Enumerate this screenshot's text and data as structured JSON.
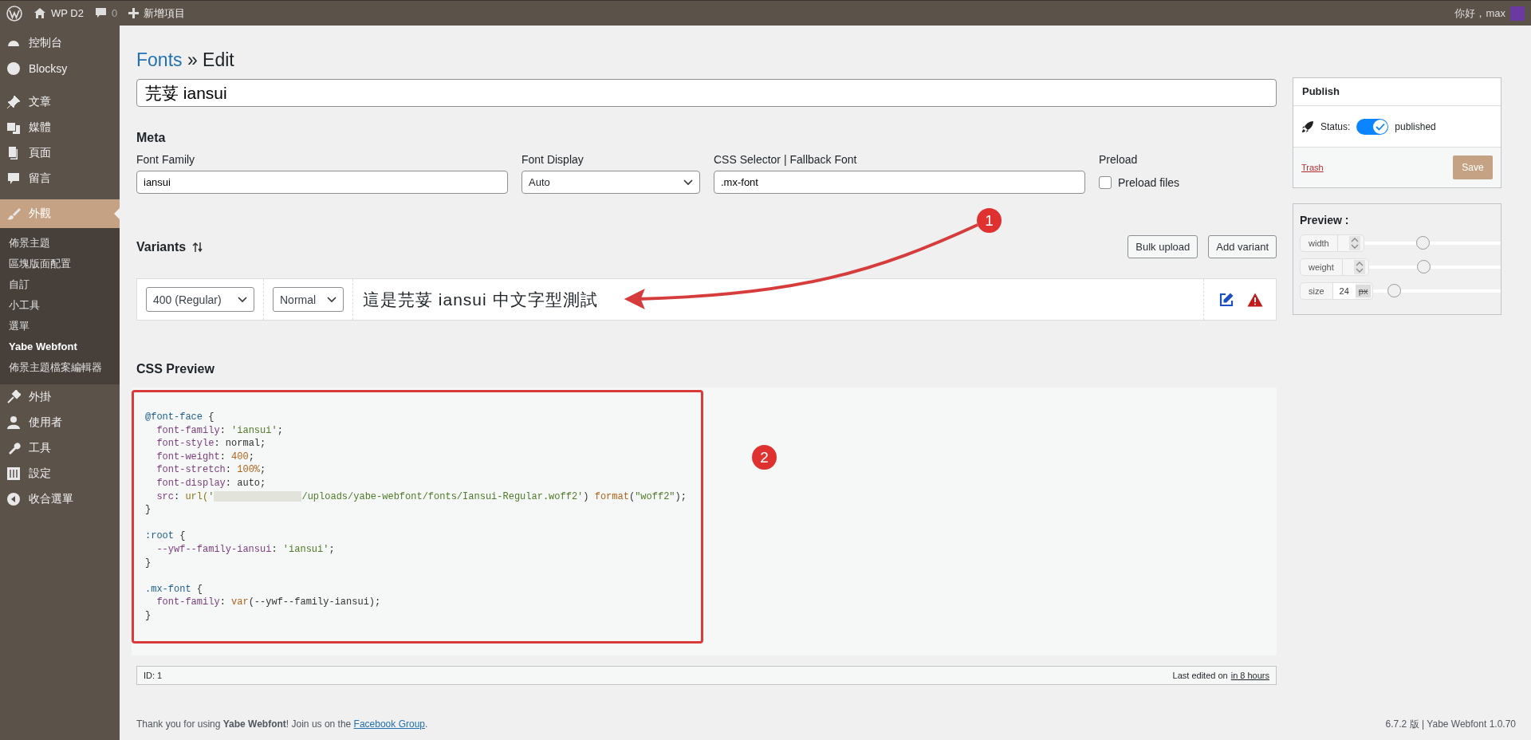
{
  "top_bar": {
    "site": "WP D2",
    "comments": "0",
    "new_item": "新增項目",
    "greeting": "你好，max"
  },
  "sidebar": {
    "groups": [
      {
        "items": [
          {
            "label": "控制台",
            "selected": false
          },
          {
            "label": "Blocksy",
            "selected": false
          }
        ]
      },
      {
        "items": [
          {
            "label": "文章",
            "selected": false
          },
          {
            "label": "媒體",
            "selected": false
          },
          {
            "label": "頁面",
            "selected": false
          },
          {
            "label": "留言",
            "selected": false
          }
        ]
      },
      {
        "items": [
          {
            "label": "外觀",
            "selected": true,
            "children": [
              {
                "label": "佈景主題",
                "selected": false
              },
              {
                "label": "區塊版面配置",
                "selected": false
              },
              {
                "label": "自訂",
                "selected": false
              },
              {
                "label": "小工具",
                "selected": false
              },
              {
                "label": "選單",
                "selected": false
              },
              {
                "label": "Yabe Webfont",
                "selected": true
              },
              {
                "label": "佈景主題檔案編輯器",
                "selected": false
              }
            ]
          },
          {
            "label": "外掛",
            "selected": false
          },
          {
            "label": "使用者",
            "selected": false
          },
          {
            "label": "工具",
            "selected": false
          },
          {
            "label": "設定",
            "selected": false
          },
          {
            "label": "收合選單",
            "selected": false
          }
        ]
      }
    ]
  },
  "breadcrumb": {
    "link": "Fonts",
    "current": "» Edit"
  },
  "title_field": {
    "value": "芫荽 iansui"
  },
  "meta": {
    "heading": "Meta",
    "font_family": {
      "label": "Font Family",
      "value": "iansui"
    },
    "font_display": {
      "label": "Font Display",
      "value": "Auto"
    },
    "css_selector": {
      "label": "CSS Selector | Fallback Font",
      "value": ".mx-font"
    },
    "preload": {
      "label": "Preload",
      "option": "Preload files",
      "checked": false
    }
  },
  "variants": {
    "heading": "Variants",
    "buttons": [
      "Bulk upload",
      "Add variant"
    ],
    "rows": [
      {
        "weight": "400 (Regular)",
        "style": "Normal",
        "preview": "這是芫荽 iansui 中文字型測試"
      }
    ]
  },
  "css_preview": {
    "heading": "CSS Preview",
    "blocks": [
      {
        "lines": [
          [
            {
              "kind": "selector",
              "text": "@font-face"
            },
            {
              "kind": "plain",
              "text": " {"
            }
          ],
          [
            {
              "kind": "prop",
              "text": "  font-family"
            },
            {
              "kind": "plain",
              "text": ": "
            },
            {
              "kind": "string",
              "text": "'iansui'"
            },
            {
              "kind": "plain",
              "text": ";"
            }
          ],
          [
            {
              "kind": "prop",
              "text": "  font-style"
            },
            {
              "kind": "plain",
              "text": ": normal;"
            }
          ],
          [
            {
              "kind": "prop",
              "text": "  font-weight"
            },
            {
              "kind": "plain",
              "text": ": "
            },
            {
              "kind": "number",
              "text": "400"
            },
            {
              "kind": "plain",
              "text": ";"
            }
          ],
          [
            {
              "kind": "prop",
              "text": "  font-stretch"
            },
            {
              "kind": "plain",
              "text": ": "
            },
            {
              "kind": "number",
              "text": "100%"
            },
            {
              "kind": "plain",
              "text": ";"
            }
          ],
          [
            {
              "kind": "prop",
              "text": "  font-display"
            },
            {
              "kind": "plain",
              "text": ": auto;"
            }
          ],
          [
            {
              "kind": "prop",
              "text": "  src"
            },
            {
              "kind": "plain",
              "text": ": "
            },
            {
              "kind": "func",
              "text": "url("
            },
            {
              "kind": "string",
              "text": "'"
            },
            {
              "kind": "redacted"
            },
            {
              "kind": "string",
              "text": "/uploads/yabe-webfont/fonts/Iansui-Regular.woff2'"
            },
            {
              "kind": "plain",
              "text": ") "
            },
            {
              "kind": "number",
              "text": "format"
            },
            {
              "kind": "plain",
              "text": "("
            },
            {
              "kind": "string",
              "text": "\"woff2\""
            },
            {
              "kind": "plain",
              "text": ");"
            }
          ],
          [
            {
              "kind": "plain",
              "text": "}"
            }
          ]
        ]
      },
      {
        "lines": [
          [
            {
              "kind": "selector",
              "text": ":root"
            },
            {
              "kind": "plain",
              "text": " {"
            }
          ],
          [
            {
              "kind": "prop",
              "text": "  --ywf--family-iansui"
            },
            {
              "kind": "plain",
              "text": ": "
            },
            {
              "kind": "string",
              "text": "'iansui'"
            },
            {
              "kind": "plain",
              "text": ";"
            }
          ],
          [
            {
              "kind": "plain",
              "text": "}"
            }
          ]
        ]
      },
      {
        "lines": [
          [
            {
              "kind": "selector",
              "text": ".mx-font"
            },
            {
              "kind": "plain",
              "text": " {"
            }
          ],
          [
            {
              "kind": "prop",
              "text": "  font-family"
            },
            {
              "kind": "plain",
              "text": ": "
            },
            {
              "kind": "number",
              "text": "var"
            },
            {
              "kind": "plain",
              "text": "(--ywf--family-iansui);"
            }
          ],
          [
            {
              "kind": "plain",
              "text": "}"
            }
          ]
        ]
      }
    ]
  },
  "status_bar": {
    "id": "ID: 1",
    "edited": "Last edited on",
    "edited_link": "in 8 hours"
  },
  "publish": {
    "title": "Publish",
    "status_label": "Status:",
    "status_on": true,
    "status_text": "published",
    "trash": "Trash",
    "save": "Save"
  },
  "preview": {
    "title": "Preview :",
    "controls": [
      {
        "label": "width",
        "level": 0.43
      },
      {
        "label": "weight",
        "level": 0.41
      },
      {
        "label": "size",
        "value": "24",
        "unit": "px",
        "level": 0.16
      }
    ]
  },
  "annotations": [
    {
      "label": "1"
    },
    {
      "label": "2"
    }
  ],
  "footer": {
    "thanks": "Thank you for using **Yabe Webfont**! Join us on the",
    "link": "Facebook Group",
    "end": ".",
    "version": "6.7.2 版 | Yabe Webfont 1.0.70"
  }
}
